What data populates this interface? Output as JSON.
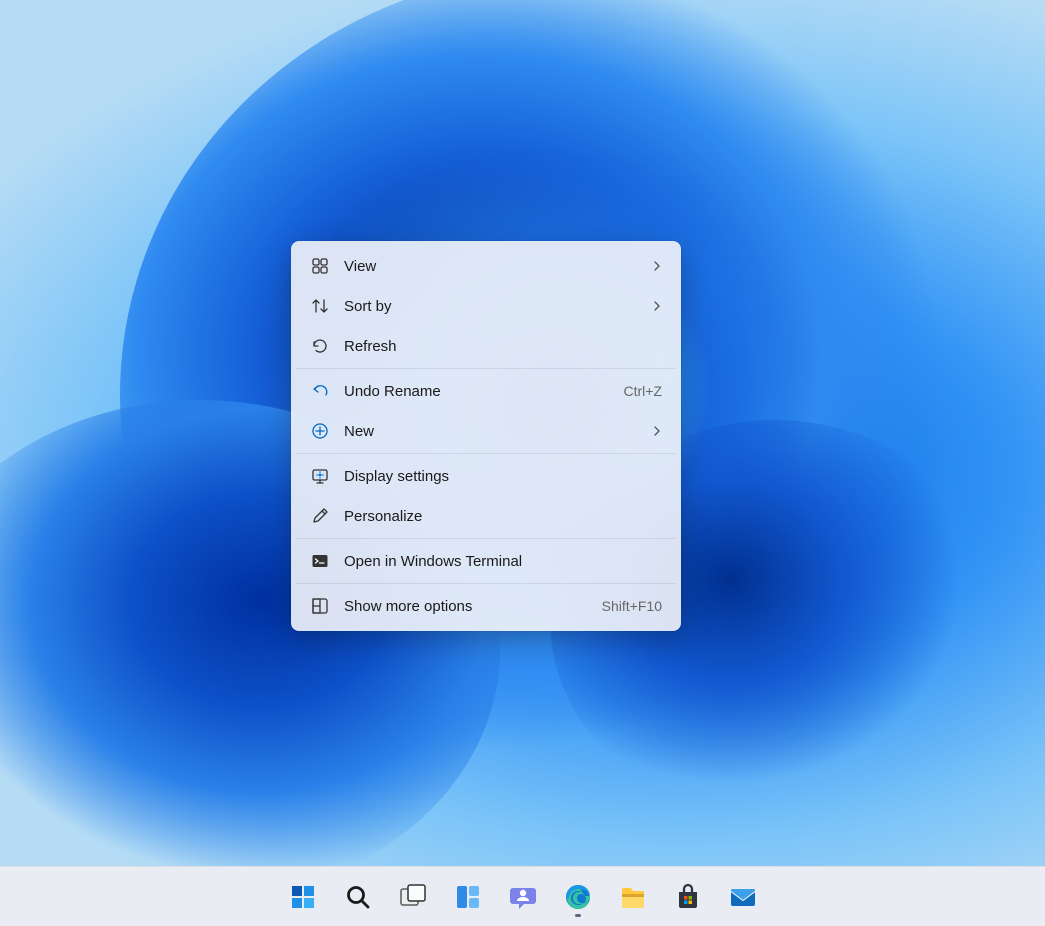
{
  "context_menu": {
    "groups": [
      [
        {
          "id": "view",
          "label": "View",
          "icon": "view-icon",
          "submenu": true
        },
        {
          "id": "sortby",
          "label": "Sort by",
          "icon": "sort-icon",
          "submenu": true
        },
        {
          "id": "refresh",
          "label": "Refresh",
          "icon": "refresh-icon"
        }
      ],
      [
        {
          "id": "undo",
          "label": "Undo Rename",
          "icon": "undo-icon",
          "shortcut": "Ctrl+Z"
        },
        {
          "id": "new",
          "label": "New",
          "icon": "new-icon",
          "submenu": true
        }
      ],
      [
        {
          "id": "display",
          "label": "Display settings",
          "icon": "display-icon"
        },
        {
          "id": "personalize",
          "label": "Personalize",
          "icon": "personalize-icon"
        }
      ],
      [
        {
          "id": "terminal",
          "label": "Open in Windows Terminal",
          "icon": "terminal-icon"
        }
      ],
      [
        {
          "id": "more",
          "label": "Show more options",
          "icon": "more-icon",
          "shortcut": "Shift+F10"
        }
      ]
    ]
  },
  "taskbar": {
    "items": [
      {
        "id": "start",
        "name": "start-button"
      },
      {
        "id": "search",
        "name": "search-button"
      },
      {
        "id": "taskview",
        "name": "task-view-button"
      },
      {
        "id": "widgets",
        "name": "widgets-button"
      },
      {
        "id": "chat",
        "name": "chat-button"
      },
      {
        "id": "edge",
        "name": "edge-button",
        "active": true
      },
      {
        "id": "explorer",
        "name": "file-explorer-button"
      },
      {
        "id": "store",
        "name": "store-button"
      },
      {
        "id": "mail",
        "name": "mail-button"
      }
    ]
  }
}
